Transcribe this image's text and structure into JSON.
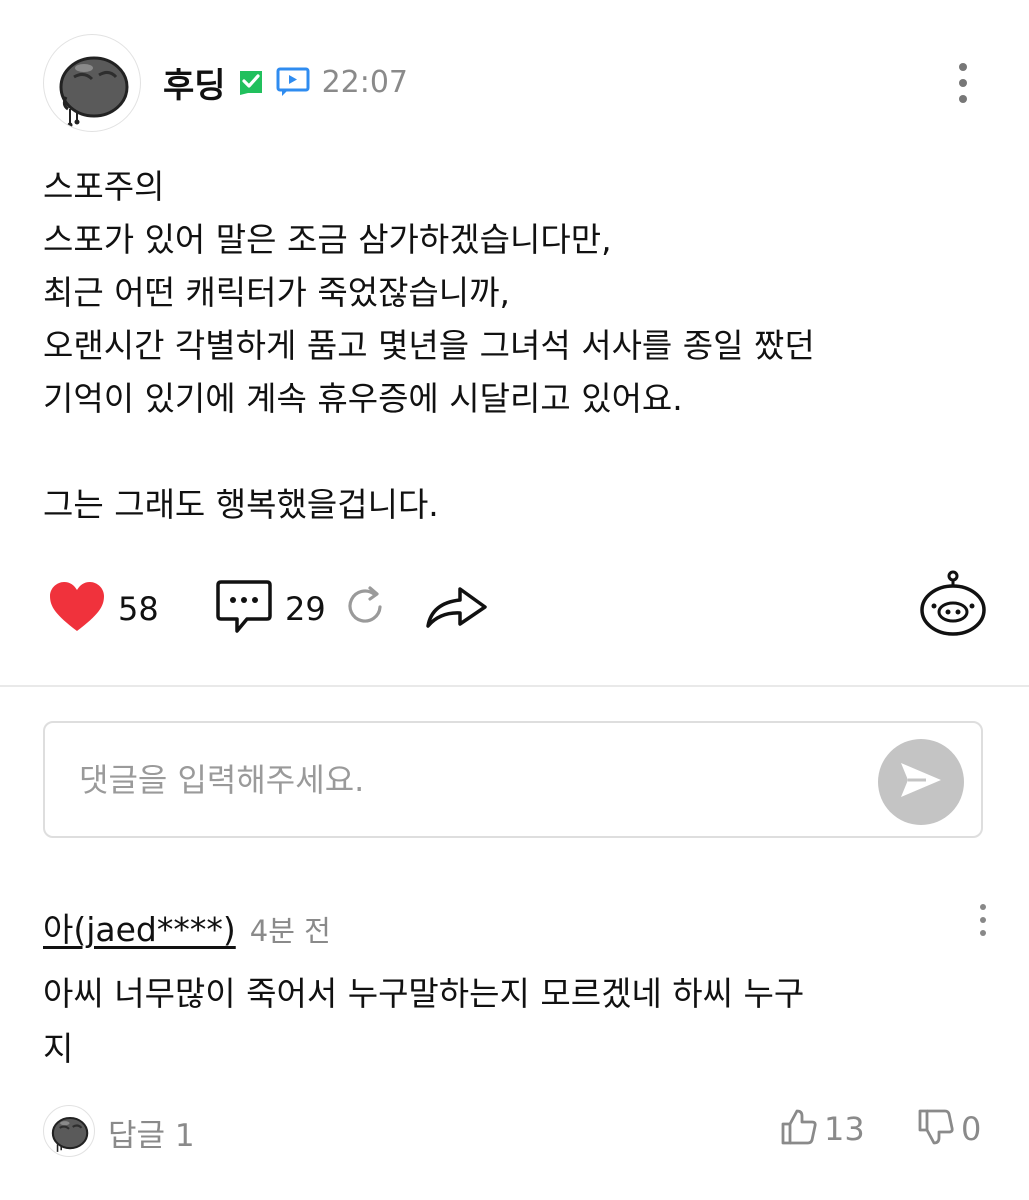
{
  "post": {
    "author": "후딩",
    "time": "22:07",
    "body_lines": [
      "스포주의",
      "스포가 있어 말은 조금 삼가하겠습니다만,",
      "최근 어떤 캐릭터가 죽었잖습니까,",
      "오랜시간 각별하게 품고 몇년을 그녀석 서사를 종일 짰던",
      "기억이 있기에 계속 휴우증에 시달리고 있어요.",
      "",
      "그는 그래도 행복했을겁니다."
    ],
    "likes": "58",
    "comments": "29",
    "icons": {
      "avatar": "blob-character-avatar",
      "verified": "green-check-badge-icon",
      "video": "video-play-badge-icon",
      "more": "kebab-menu-icon",
      "like": "heart-icon",
      "comment": "speech-bubble-icon",
      "refresh": "refresh-icon",
      "share": "share-arrow-icon",
      "mascot": "mascot-face-icon"
    },
    "colors": {
      "like": "#f0323c",
      "verified": "#21c05d",
      "video": "#2f8cf0"
    }
  },
  "comment_input": {
    "placeholder": "댓글을 입력해주세요.",
    "value": "",
    "send_icon": "send-icon"
  },
  "comment": {
    "author": "아(jaed****)",
    "time": "4분 전",
    "text_lines": [
      "아씨 너무많이 죽어서 누구말하는지 모르겠네 하씨 누구",
      "지"
    ],
    "reply_label": "답글 1",
    "upvotes": "13",
    "downvotes": "0"
  }
}
